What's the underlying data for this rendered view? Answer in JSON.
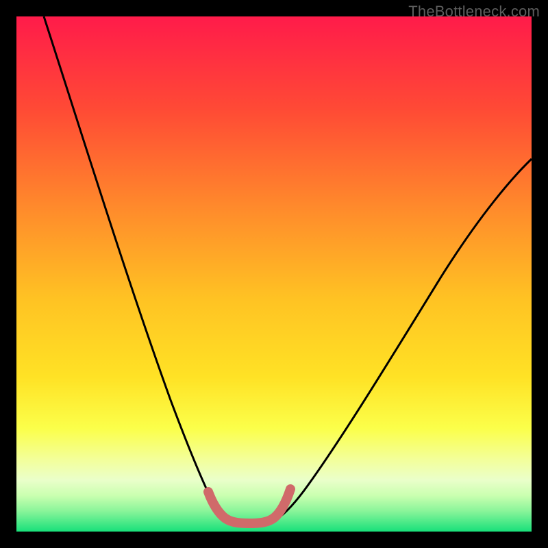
{
  "watermark": "TheBottleneck.com",
  "chart_data": {
    "type": "line",
    "title": "",
    "xlabel": "",
    "ylabel": "",
    "xlim": [
      0,
      100
    ],
    "ylim": [
      0,
      100
    ],
    "grid": false,
    "series": [
      {
        "name": "left-curve",
        "x": [
          5,
          8,
          11,
          14,
          17,
          20,
          23,
          26,
          29,
          32,
          34,
          36,
          38
        ],
        "y": [
          100,
          89,
          78,
          67,
          56,
          46,
          36,
          27,
          19,
          12,
          8,
          5,
          3
        ],
        "color": "#000000"
      },
      {
        "name": "right-curve",
        "x": [
          48,
          50,
          53,
          56,
          60,
          65,
          70,
          76,
          82,
          88,
          94,
          100
        ],
        "y": [
          3,
          5,
          9,
          14,
          20,
          27,
          34,
          42,
          50,
          58,
          65,
          72
        ],
        "color": "#000000"
      },
      {
        "name": "bottom-marker",
        "x": [
          36,
          37,
          38,
          39,
          40,
          41,
          42,
          43,
          44,
          45,
          46,
          47,
          48,
          49
        ],
        "y": [
          7,
          5,
          3.5,
          2.8,
          2.5,
          2.4,
          2.4,
          2.4,
          2.5,
          2.8,
          3.5,
          5,
          7,
          9
        ],
        "color": "#d06a6a"
      }
    ],
    "background_gradient": {
      "top": "#ff1b4a",
      "mid_upper": "#ff8d2b",
      "mid": "#ffe225",
      "mid_lower": "#f8ff66",
      "lower": "#caffb0",
      "bottom": "#18e07a"
    }
  }
}
